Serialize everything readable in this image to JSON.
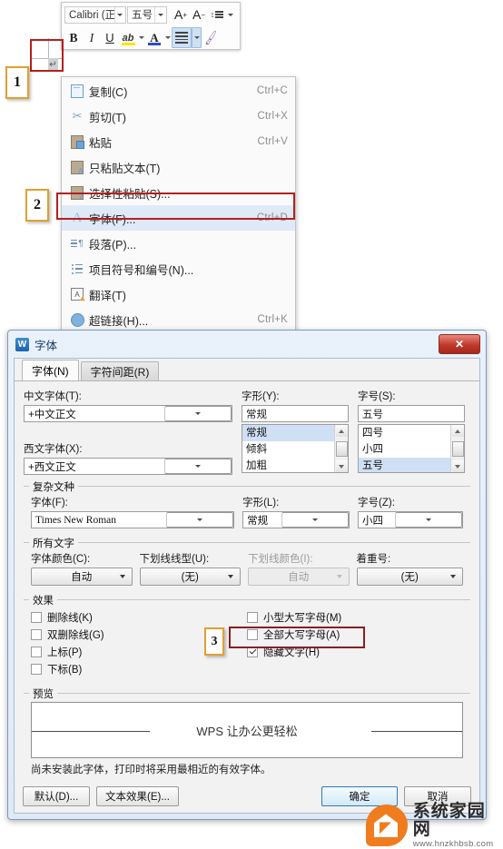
{
  "toolbar": {
    "font_name": "Calibri (正",
    "font_size": "五号",
    "grow_font_label": "A",
    "shrink_font_label": "A",
    "line_spacing_icon": "line-spacing-icon",
    "bold_label": "B",
    "italic_label": "I",
    "underline_label": "U",
    "highlight_label": "ab",
    "font_color_label": "A",
    "align_icon": "align-icon",
    "format_painter_icon": "format-painter-icon"
  },
  "document": {
    "paragraph_mark": "↵"
  },
  "context_menu": {
    "items": [
      {
        "label": "复制(C)",
        "shortcut": "Ctrl+C",
        "icon": "copy-icon"
      },
      {
        "label": "剪切(T)",
        "shortcut": "Ctrl+X",
        "icon": "cut-icon"
      },
      {
        "label": "粘贴",
        "shortcut": "Ctrl+V",
        "icon": "paste-icon"
      },
      {
        "label": "只粘贴文本(T)",
        "shortcut": "",
        "icon": "paste-text-only-icon"
      },
      {
        "label": "选择性粘贴(S)...",
        "shortcut": "",
        "icon": "paste-special-icon"
      },
      {
        "label": "字体(F)...",
        "shortcut": "Ctrl+D",
        "icon": "font-icon"
      },
      {
        "label": "段落(P)...",
        "shortcut": "",
        "icon": "paragraph-icon"
      },
      {
        "label": "项目符号和编号(N)...",
        "shortcut": "",
        "icon": "bullets-numbering-icon"
      },
      {
        "label": "翻译(T)",
        "shortcut": "",
        "icon": "translate-icon"
      },
      {
        "label": "超链接(H)...",
        "shortcut": "Ctrl+K",
        "icon": "hyperlink-icon"
      }
    ]
  },
  "steps": {
    "one": "1",
    "two": "2",
    "three": "3"
  },
  "dialog": {
    "title": "字体",
    "close_label": "✕",
    "tabs": [
      {
        "label": "字体(N)",
        "active": true
      },
      {
        "label": "字符间距(R)",
        "active": false
      }
    ],
    "chinese_font": {
      "label": "中文字体(T):",
      "value": "+中文正文"
    },
    "western_font": {
      "label": "西文字体(X):",
      "value": "+西文正文"
    },
    "style": {
      "label": "字形(Y):",
      "value": "常规",
      "options": [
        "常规",
        "倾斜",
        "加粗"
      ],
      "selected": "常规"
    },
    "size": {
      "label": "字号(S):",
      "value": "五号",
      "options": [
        "四号",
        "小四",
        "五号"
      ],
      "selected": "五号"
    },
    "complex_script": {
      "group_label": "复杂文种",
      "font": {
        "label": "字体(F):",
        "value": "Times New Roman"
      },
      "style": {
        "label": "字形(L):",
        "value": "常规"
      },
      "size": {
        "label": "字号(Z):",
        "value": "小四"
      }
    },
    "all_text": {
      "group_label": "所有文字",
      "font_color": {
        "label": "字体颜色(C):",
        "value": "自动",
        "disabled": false
      },
      "underline_style": {
        "label": "下划线线型(U):",
        "value": "(无)",
        "disabled": false
      },
      "underline_color": {
        "label": "下划线颜色(I):",
        "value": "自动",
        "disabled": true
      },
      "emphasis_mark": {
        "label": "着重号:",
        "value": "(无)",
        "disabled": false
      }
    },
    "effects": {
      "group_label": "效果",
      "left": [
        {
          "label": "删除线(K)",
          "checked": false
        },
        {
          "label": "双删除线(G)",
          "checked": false
        },
        {
          "label": "上标(P)",
          "checked": false
        },
        {
          "label": "下标(B)",
          "checked": false
        }
      ],
      "right": [
        {
          "label": "小型大写字母(M)",
          "checked": false
        },
        {
          "label": "全部大写字母(A)",
          "checked": false
        },
        {
          "label": "隐藏文字(H)",
          "checked": true
        }
      ]
    },
    "preview": {
      "group_label": "预览",
      "text": "WPS 让办公更轻松",
      "note": "尚未安装此字体，打印时将采用最相近的有效字体。"
    },
    "footer": {
      "default_button": "默认(D)...",
      "text_effects_button": "文本效果(E)...",
      "ok_button": "确定",
      "cancel_button": "取消"
    }
  },
  "watermark": {
    "title": "系统家园网",
    "url": "www.hnzkhbsb.com"
  },
  "colors": {
    "accent": "#2f6fd0",
    "highlight_box": "#b41f1f",
    "step_marker": "#e0a030",
    "watermark_orange": "#f07c1e",
    "selection_blue": "#cfe0f5"
  }
}
